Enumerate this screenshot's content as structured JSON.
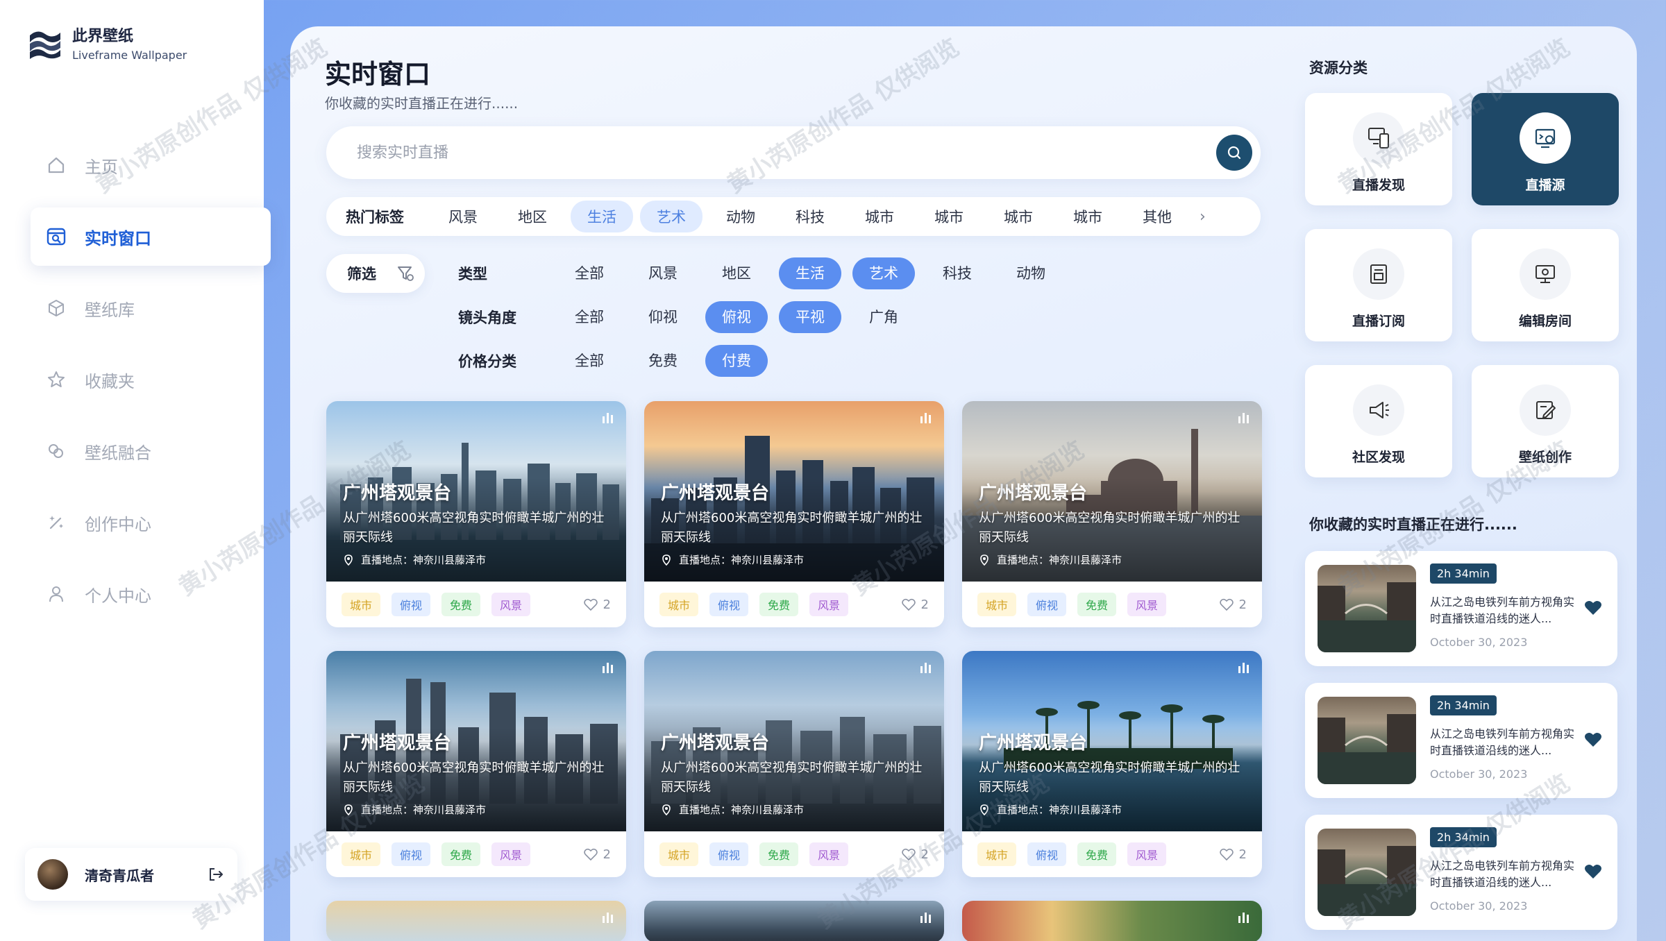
{
  "brand": {
    "name": "此界壁纸",
    "sub": "Liveframe Wallpaper"
  },
  "nav": [
    {
      "label": "主页",
      "icon": "home-icon"
    },
    {
      "label": "实时窗口",
      "icon": "live-window-icon"
    },
    {
      "label": "壁纸库",
      "icon": "cube-icon"
    },
    {
      "label": "收藏夹",
      "icon": "star-icon"
    },
    {
      "label": "壁纸融合",
      "icon": "merge-icon"
    },
    {
      "label": "创作中心",
      "icon": "sparkle-icon"
    },
    {
      "label": "个人中心",
      "icon": "user-icon"
    }
  ],
  "profile": {
    "name": "清奇青瓜者"
  },
  "page": {
    "title": "实时窗口",
    "subtitle": "你收藏的实时直播正在进行......"
  },
  "search": {
    "placeholder": "搜索实时直播"
  },
  "tags": {
    "title": "热门标签",
    "items": [
      "风景",
      "地区",
      "生活",
      "艺术",
      "动物",
      "科技",
      "城市",
      "城市",
      "城市",
      "城市",
      "其他"
    ],
    "highlighted": [
      2,
      3
    ]
  },
  "filter": {
    "button": "筛选",
    "rows": [
      {
        "label": "类型",
        "options": [
          "全部",
          "风景",
          "地区",
          "生活",
          "艺术",
          "科技",
          "动物"
        ],
        "selected": [
          3,
          4
        ]
      },
      {
        "label": "镜头角度",
        "options": [
          "全部",
          "仰视",
          "俯视",
          "平视",
          "广角"
        ],
        "selected": [
          2,
          3
        ]
      },
      {
        "label": "价格分类",
        "options": [
          "全部",
          "免费",
          "付费"
        ],
        "selected": [
          2
        ]
      }
    ]
  },
  "cards": [
    {
      "title": "广州塔观景台",
      "desc": "从广州塔600米高空视角实时俯瞰羊城广州的壮丽天际线",
      "location": "直播地点：神奈川县藤泽市",
      "tags": [
        "城市",
        "俯视",
        "免费",
        "风景"
      ],
      "likes": "2"
    },
    {
      "title": "广州塔观景台",
      "desc": "从广州塔600米高空视角实时俯瞰羊城广州的壮丽天际线",
      "location": "直播地点：神奈川县藤泽市",
      "tags": [
        "城市",
        "俯视",
        "免费",
        "风景"
      ],
      "likes": "2"
    },
    {
      "title": "广州塔观景台",
      "desc": "从广州塔600米高空视角实时俯瞰羊城广州的壮丽天际线",
      "location": "直播地点：神奈川县藤泽市",
      "tags": [
        "城市",
        "俯视",
        "免费",
        "风景"
      ],
      "likes": "2"
    },
    {
      "title": "广州塔观景台",
      "desc": "从广州塔600米高空视角实时俯瞰羊城广州的壮丽天际线",
      "location": "直播地点：神奈川县藤泽市",
      "tags": [
        "城市",
        "俯视",
        "免费",
        "风景"
      ],
      "likes": "2"
    },
    {
      "title": "广州塔观景台",
      "desc": "从广州塔600米高空视角实时俯瞰羊城广州的壮丽天际线",
      "location": "直播地点：神奈川县藤泽市",
      "tags": [
        "城市",
        "俯视",
        "免费",
        "风景"
      ],
      "likes": "2"
    },
    {
      "title": "广州塔观景台",
      "desc": "从广州塔600米高空视角实时俯瞰羊城广州的壮丽天际线",
      "location": "直播地点：神奈川县藤泽市",
      "tags": [
        "城市",
        "俯视",
        "免费",
        "风景"
      ],
      "likes": "2"
    }
  ],
  "resources": {
    "title": "资源分类",
    "items": [
      {
        "label": "直播发现",
        "icon": "devices-icon"
      },
      {
        "label": "直播源",
        "icon": "live-source-icon"
      },
      {
        "label": "直播订阅",
        "icon": "subscription-icon"
      },
      {
        "label": "编辑房间",
        "icon": "monitor-settings-icon"
      },
      {
        "label": "社区发现",
        "icon": "megaphone-icon"
      },
      {
        "label": "壁纸创作",
        "icon": "edit-note-icon"
      }
    ]
  },
  "favorites": {
    "title": "你收藏的实时直播正在进行......",
    "items": [
      {
        "duration": "2h 34min",
        "desc": "从江之岛电铁列车前方视角实时直播铁道沿线的迷人...",
        "date": "October 30, 2023"
      },
      {
        "duration": "2h 34min",
        "desc": "从江之岛电铁列车前方视角实时直播铁道沿线的迷人...",
        "date": "October 30, 2023"
      },
      {
        "duration": "2h 34min",
        "desc": "从江之岛电铁列车前方视角实时直播铁道沿线的迷人...",
        "date": "October 30, 2023"
      }
    ]
  },
  "watermark": "黄小芮原创作品 仅供阅览",
  "colors": {
    "accent": "#5b8ef0",
    "dark": "#1e4867",
    "active_text": "#1f5fd6"
  }
}
